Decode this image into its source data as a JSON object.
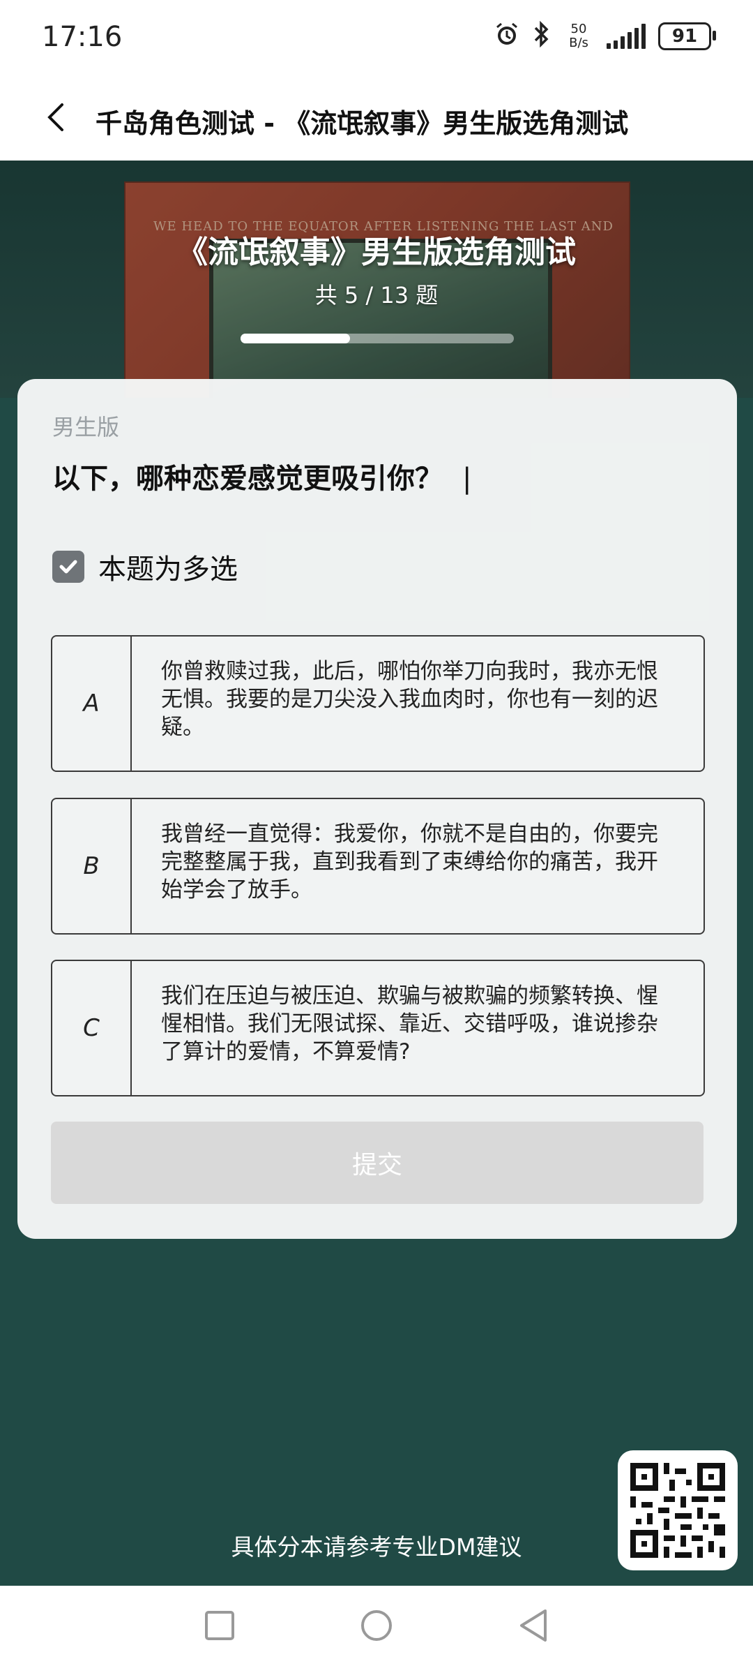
{
  "status_bar": {
    "time": "17:16",
    "net_speed_value": "50",
    "net_speed_unit": "B/s",
    "battery": "91",
    "icons": [
      "alarm-icon",
      "bluetooth-icon",
      "signal-icon",
      "battery-icon"
    ]
  },
  "nav": {
    "title": "千岛角色测试 - 《流氓叙事》男生版选角测试",
    "back_icon": "chevron-left-icon"
  },
  "hero": {
    "book_text": "WE HEAD TO THE EQUATOR AFTER LISTENING THE LAST AND",
    "title": "《流氓叙事》男生版选角测试",
    "count_text": "共 5 / 13 题",
    "progress": 0.4
  },
  "quiz": {
    "version_label": "男生版",
    "question": "以下，哪种恋爱感觉更吸引你？",
    "multi_select_label": "本题为多选",
    "multi_select_checked": true,
    "options": [
      {
        "letter": "A",
        "text": "你曾救赎过我，此后，哪怕你举刀向我时，我亦无恨无惧。我要的是刀尖没入我血肉时，你也有一刻的迟疑。"
      },
      {
        "letter": "B",
        "text": "我曾经一直觉得：我爱你，你就不是自由的，你要完完整整属于我，直到我看到了束缚给你的痛苦，我开始学会了放手。"
      },
      {
        "letter": "C",
        "text": "我们在压迫与被压迫、欺骗与被欺骗的频繁转换、惺惺相惜。我们无限试探、靠近、交错呼吸，谁说掺杂了算计的爱情，不算爱情?"
      }
    ],
    "submit_label": "提交"
  },
  "footer": {
    "note": "具体分本请参考专业DM建议"
  },
  "colors": {
    "background": "#204a45",
    "card": "#f5f7f7",
    "submit_disabled": "#d9d9d9"
  }
}
